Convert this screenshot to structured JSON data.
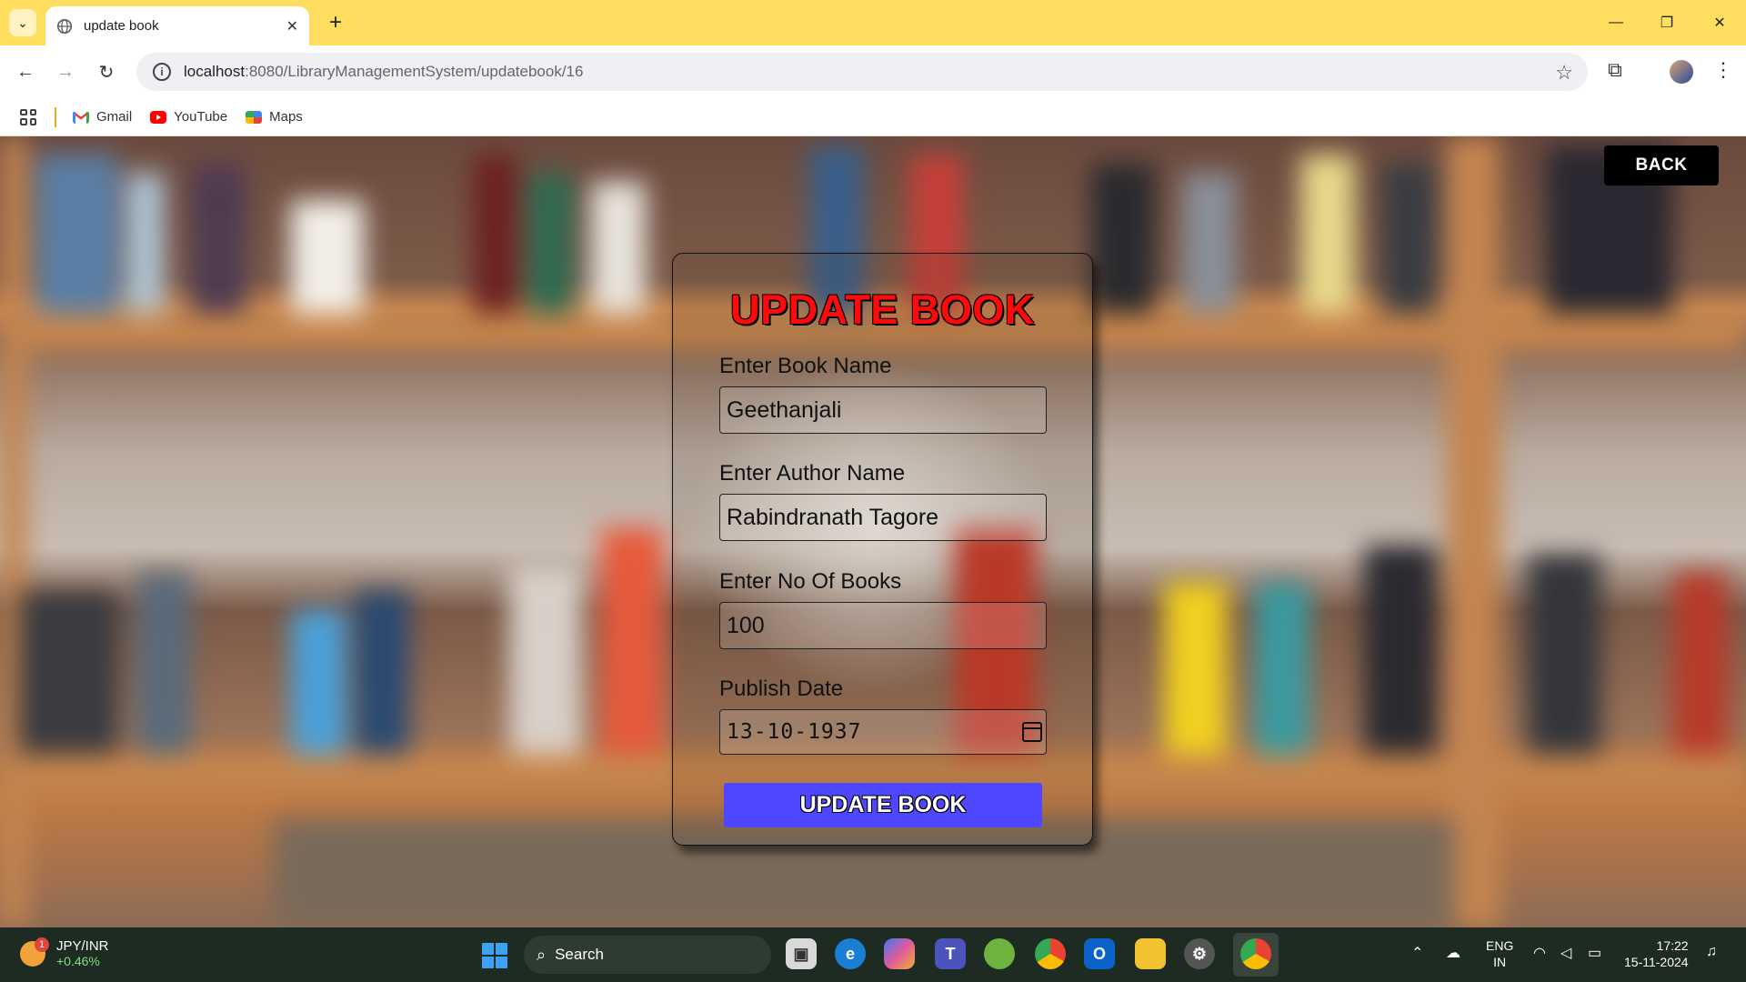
{
  "browser": {
    "tab_title": "update book",
    "url_host": "localhost",
    "url_path": ":8080/LibraryManagementSystem/updatebook/16",
    "bookmarks": [
      {
        "label": "Gmail",
        "icon": "gmail-icon"
      },
      {
        "label": "YouTube",
        "icon": "youtube-icon"
      },
      {
        "label": "Maps",
        "icon": "maps-icon"
      }
    ]
  },
  "page": {
    "back_label": "BACK",
    "heading": "UPDATE BOOK",
    "fields": {
      "book_name": {
        "label": "Enter Book Name",
        "value": "Geethanjali"
      },
      "author_name": {
        "label": "Enter Author Name",
        "value": "Rabindranath Tagore"
      },
      "no_of_books": {
        "label": "Enter No Of Books",
        "value": "100"
      },
      "publish_date": {
        "label": "Publish Date",
        "value": "13-10-1937"
      }
    },
    "submit_label": "UPDATE BOOK",
    "colors": {
      "heading": "#ff0a0a",
      "submit_bg": "#4f46ff",
      "back_bg": "#000000"
    }
  },
  "taskbar": {
    "ticker_name": "JPY/INR",
    "ticker_change": "+0.46%",
    "ticker_badge": "1",
    "search_label": "Search",
    "lang_top": "ENG",
    "lang_bottom": "IN",
    "time": "17:22",
    "date": "15-11-2024"
  }
}
